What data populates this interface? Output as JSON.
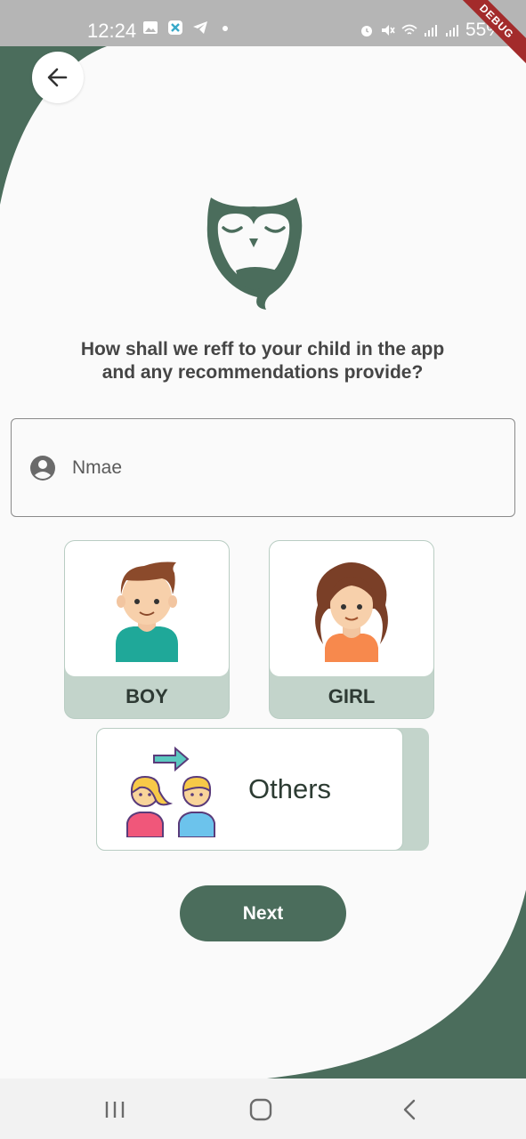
{
  "status_bar": {
    "time": "12:24",
    "battery": "55%",
    "debug_label": "DEBUG"
  },
  "colors": {
    "brand_green": "#4b6d5c",
    "card_tint": "#c3d4cb",
    "background": "#fafafa"
  },
  "header": {
    "back_icon": "arrow-left-icon"
  },
  "logo": {
    "icon": "owl-logo"
  },
  "question": "How shall we reff to your child in the app and any recommendations provide?",
  "name_field": {
    "placeholder": "Nmae",
    "value": "",
    "icon": "account-circle-icon"
  },
  "gender_options": [
    {
      "label": "BOY",
      "icon": "boy-avatar"
    },
    {
      "label": "GIRL",
      "icon": "girl-avatar"
    }
  ],
  "others_option": {
    "label": "Others",
    "icon": "gender-swap-illustration"
  },
  "next_button": {
    "label": "Next"
  },
  "nav_bar": {
    "items": [
      "recent-apps-icon",
      "home-icon",
      "back-icon"
    ]
  }
}
